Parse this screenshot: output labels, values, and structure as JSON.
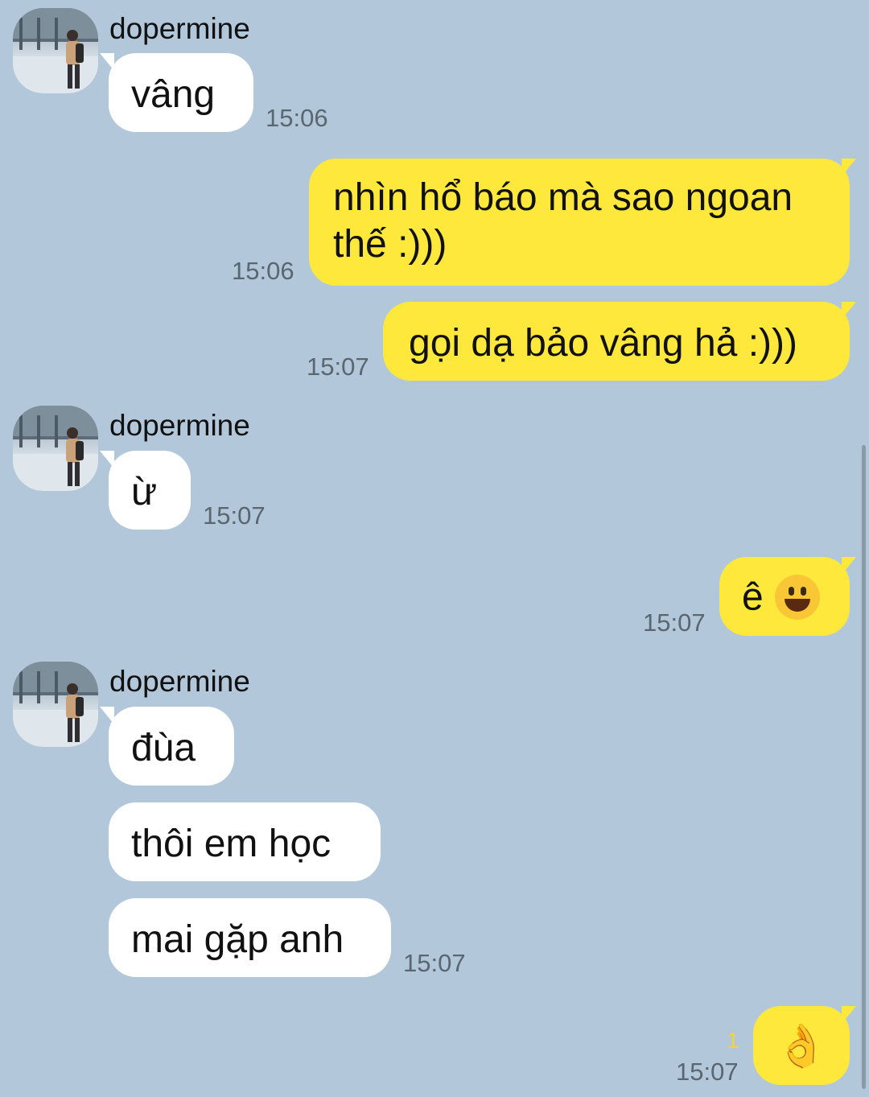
{
  "sender_name": "dopermine",
  "messages": [
    {
      "text": "vâng",
      "time": "15:06"
    },
    {
      "text": "nhìn hổ báo mà sao ngoan thế :)))",
      "time": "15:06"
    },
    {
      "text": "gọi dạ bảo vâng hả :)))",
      "time": "15:07"
    },
    {
      "text": "ừ",
      "time": "15:07"
    },
    {
      "text": "ê",
      "emoji": "grinning-face-icon",
      "time": "15:07"
    },
    {
      "text": "đùa"
    },
    {
      "text": "thôi em học"
    },
    {
      "text": "mai gặp anh",
      "time": "15:07"
    },
    {
      "emoji": "ok-hand-icon",
      "emoji_char": "👌",
      "unread_count": "1",
      "time": "15:07"
    }
  ],
  "colors": {
    "background": "#b2c7da",
    "incoming_bubble": "#ffffff",
    "outgoing_bubble": "#fee83b",
    "unread": "#f2d33d"
  }
}
